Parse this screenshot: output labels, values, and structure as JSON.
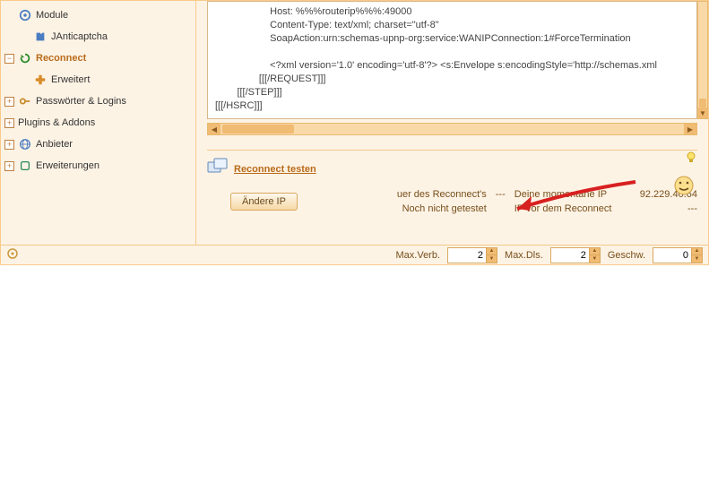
{
  "sidebar": {
    "items": [
      {
        "label": "Module",
        "icon": "gear"
      },
      {
        "label": "JAnticaptcha",
        "icon": "puzzle",
        "indent": 2
      },
      {
        "label": "Reconnect",
        "icon": "reload",
        "selected": true,
        "exp": "-"
      },
      {
        "label": "Erweitert",
        "icon": "tool",
        "indent": 2
      },
      {
        "label": "Passwörter & Logins",
        "icon": "key",
        "exp": "+"
      },
      {
        "label": "Plugins & Addons",
        "icon": "plug",
        "exp": "+"
      },
      {
        "label": "Anbieter",
        "icon": "globe",
        "exp": "+"
      },
      {
        "label": "Erweiterungen",
        "icon": "ext",
        "exp": "+"
      }
    ]
  },
  "request_text": "                    Host: %%%routerip%%%:49000\n                    Content-Type: text/xml; charset=\"utf-8\"\n                    SoapAction:urn:schemas-upnp-org:service:WANIPConnection:1#ForceTermination\n\n                    <?xml version='1.0' encoding='utf-8'?> <s:Envelope s:encodingStyle='http://schemas.xml\n                [[[/REQUEST]]]\n        [[[/STEP]]]\n[[[/HSRC]]]",
  "test": {
    "title": "Reconnect testen",
    "button": "Ändere IP",
    "duration_label": "uer des Reconnect's",
    "duration_val": "---",
    "current_ip_label": "Deine momentane IP",
    "current_ip_val": "92.229.40.64",
    "tested_label": "Noch nicht getestet",
    "before_label": "IP vor dem Reconnect",
    "before_val": "---"
  },
  "statusbar": {
    "maxverb": {
      "label": "Max.Verb.",
      "value": "2"
    },
    "maxdls": {
      "label": "Max.Dls.",
      "value": "2"
    },
    "geschw": {
      "label": "Geschw.",
      "value": "0"
    }
  }
}
